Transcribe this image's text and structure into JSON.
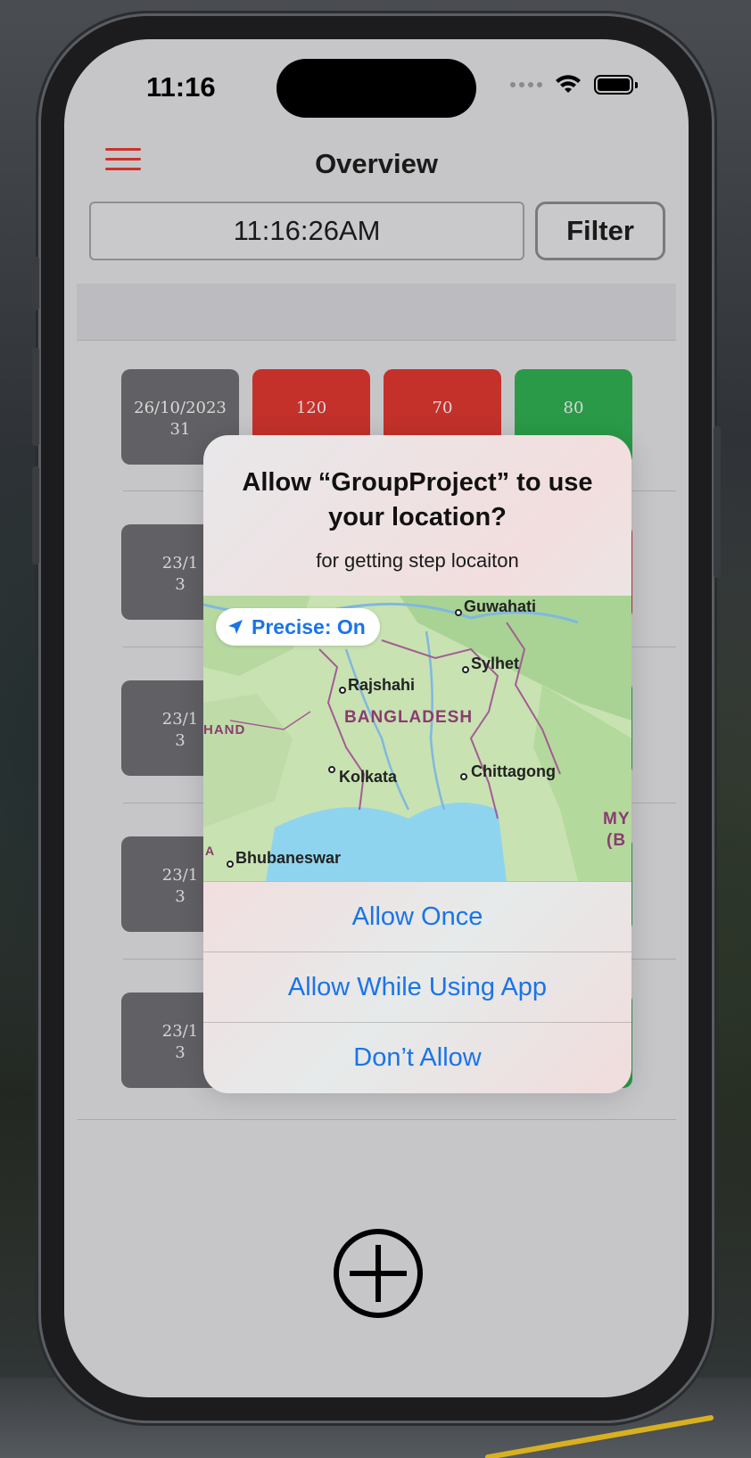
{
  "status_bar": {
    "time": "11:16"
  },
  "nav": {
    "title": "Overview"
  },
  "controls": {
    "time_value": "11:16:26AM",
    "filter_label": "Filter"
  },
  "rows": [
    {
      "date": "26/10/2023",
      "date2": "31",
      "systolic": "120",
      "diastolic": "70",
      "pulse": "80"
    },
    {
      "date": "23/1",
      "date2": "3"
    },
    {
      "date": "23/1",
      "date2": "3"
    },
    {
      "date": "23/1",
      "date2": "3"
    },
    {
      "date": "23/1",
      "date2": "3"
    }
  ],
  "alert": {
    "title": "Allow “GroupProject” to use your location?",
    "message": "for getting step locaiton",
    "precise_label": "Precise: On",
    "map_labels": {
      "guwahati": "Guwahati",
      "sylhet": "Sylhet",
      "rajshahi": "Rajshahi",
      "bangladesh": "BANGLADESH",
      "jharkhand": "HAND",
      "kolkata": "Kolkata",
      "chittagong": "Chittagong",
      "myanmar": "MY",
      "myanmar2": "(B",
      "odisha": "A",
      "bhubaneswar": "Bhubaneswar"
    },
    "buttons": {
      "allow_once": "Allow Once",
      "allow_while": "Allow While Using App",
      "dont_allow": "Don’t Allow"
    }
  },
  "colors": {
    "accent_red": "#c4312b",
    "accent_green": "#2a9a48",
    "date_gray": "#616165",
    "ios_blue": "#1a74e8",
    "menu_red": "#d0302a"
  },
  "icons": {
    "menu": "hamburger-icon",
    "add": "plus-circle-icon",
    "location": "location-arrow-icon",
    "wifi": "wifi-icon",
    "battery": "battery-icon",
    "signal": "signal-dots-icon"
  }
}
